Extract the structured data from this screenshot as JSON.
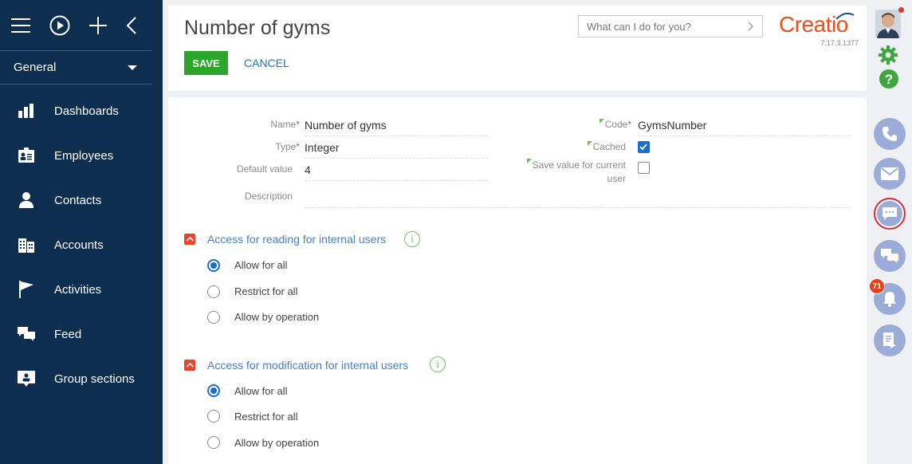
{
  "sidebar": {
    "workspace": "General",
    "items": [
      {
        "label": "Dashboards",
        "icon": "dashboards-icon"
      },
      {
        "label": "Employees",
        "icon": "employees-icon"
      },
      {
        "label": "Contacts",
        "icon": "contacts-icon"
      },
      {
        "label": "Accounts",
        "icon": "accounts-icon"
      },
      {
        "label": "Activities",
        "icon": "activities-icon"
      },
      {
        "label": "Feed",
        "icon": "feed-icon"
      },
      {
        "label": "Group sections",
        "icon": "group-sections-icon"
      }
    ]
  },
  "header": {
    "title": "Number of gyms",
    "save_label": "SAVE",
    "cancel_label": "CANCEL",
    "search_placeholder": "What can I do for you?",
    "logo": "Creatio",
    "version": "7.17.3.1377"
  },
  "form": {
    "name_label": "Name",
    "name_value": "Number of gyms",
    "type_label": "Type",
    "type_value": "Integer",
    "default_label": "Default value",
    "default_value": "4",
    "description_label": "Description",
    "description_value": "",
    "code_label": "Code",
    "code_value": "GymsNumber",
    "cached_label": "Cached",
    "cached_checked": true,
    "save_current_label_1": "Save value for current",
    "save_current_label_2": "user",
    "save_current_checked": false
  },
  "sections": [
    {
      "title": "Access for reading for internal users",
      "options": [
        "Allow for all",
        "Restrict for all",
        "Allow by operation"
      ],
      "selected": 0
    },
    {
      "title": "Access for modification for internal users",
      "options": [
        "Allow for all",
        "Restrict for all",
        "Allow by operation"
      ],
      "selected": 0
    }
  ],
  "right_panel": {
    "notification_count": "71"
  },
  "colors": {
    "sidebar_bg": "#0d2e4e",
    "save_green": "#2ba62b",
    "link_blue": "#1a73c6",
    "brand_orange": "#f24d1b",
    "section_toggle": "#e8452c",
    "comm_button": "#9bacd8"
  }
}
